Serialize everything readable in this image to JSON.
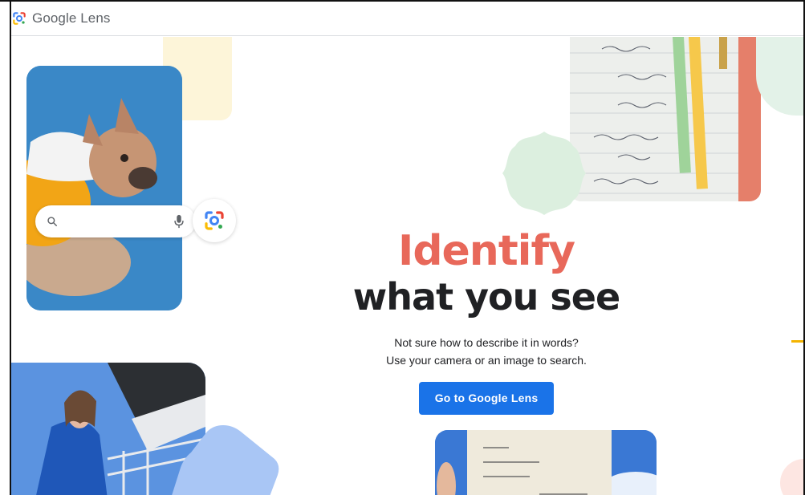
{
  "app": {
    "title": "Google Lens",
    "brand_colors": {
      "blue": "#4285f4",
      "red": "#ea4335",
      "yellow": "#fbbc04",
      "green": "#34a853",
      "accent_heading": "#e8685a",
      "cta_blue": "#1a73e8"
    }
  },
  "hero": {
    "accent_line": "Identify",
    "main_line": "what you see",
    "subtitle_line1": "Not sure how to describe it in words?",
    "subtitle_line2": "Use your camera or an image to search.",
    "cta_label": "Go to Google Lens"
  },
  "search_widget": {
    "icon": "search-icon",
    "mic_icon": "mic-icon",
    "lens_icon": "google-lens-icon"
  },
  "illustrations": {
    "dog_photo": "french-bulldog-photo",
    "math_photo": "math-notebook-photo",
    "woman_photo": "woman-portrait-photo",
    "paper_photo": "korean-text-note-photo"
  }
}
